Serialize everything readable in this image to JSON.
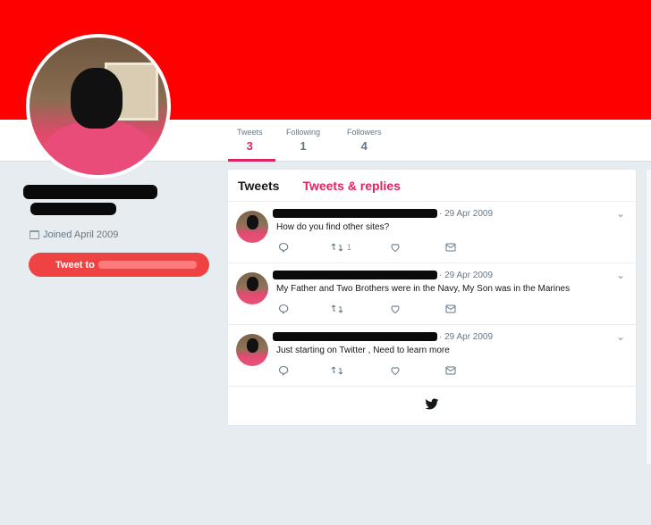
{
  "profile": {
    "joined": "Joined April 2009",
    "tweet_to_prefix": "Tweet to"
  },
  "stats": [
    {
      "label": "Tweets",
      "value": "3"
    },
    {
      "label": "Following",
      "value": "1"
    },
    {
      "label": "Followers",
      "value": "4"
    }
  ],
  "tabs": {
    "tweets": "Tweets",
    "replies": "Tweets & replies"
  },
  "tweets": [
    {
      "date": "· 29 Apr 2009",
      "text": "How do you find other sites?",
      "retweets": "1",
      "chevron": "⌄"
    },
    {
      "date": "· 29 Apr 2009",
      "text": "My Father and Two Brothers were in the Navy, My Son was in the Marines",
      "retweets": "",
      "chevron": "⌄"
    },
    {
      "date": "· 29 Apr 2009",
      "text": "Just  starting on Twitter , Need to learn more",
      "retweets": "",
      "chevron": "⌄"
    }
  ],
  "icons": {
    "reply": "reply-icon",
    "retweet": "retweet-icon",
    "like": "heart-icon",
    "message": "envelope-icon",
    "footer": "twitter-bird-icon"
  },
  "colors": {
    "banner": "#ff0000",
    "accent": "#e0245e",
    "button": "#ef4242"
  }
}
